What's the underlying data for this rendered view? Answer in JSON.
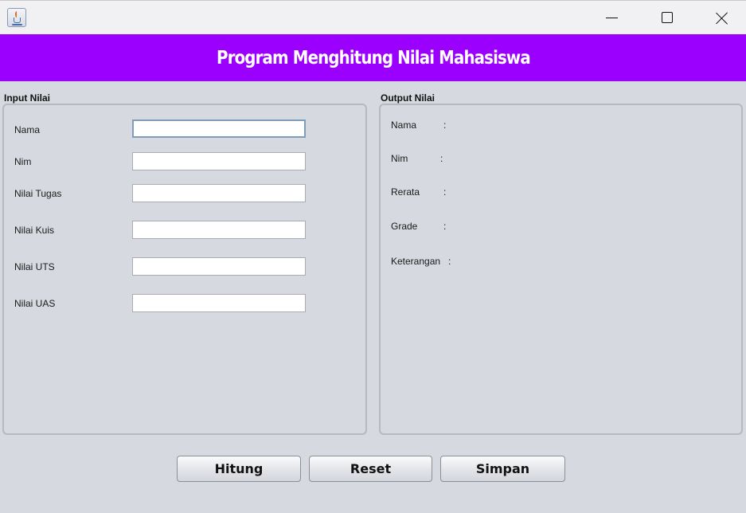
{
  "window": {
    "app_icon": "java-coffee-cup-icon",
    "controls": {
      "minimize": "minimize-icon",
      "maximize": "maximize-icon",
      "close": "close-icon"
    }
  },
  "banner": {
    "title": "Program Menghitung Nilai Mahasiswa",
    "color": "#9b00ff"
  },
  "input_panel": {
    "title": "Input Nilai",
    "fields": [
      {
        "label": "Nama",
        "value": ""
      },
      {
        "label": "Nim",
        "value": ""
      },
      {
        "label": "Nilai Tugas",
        "value": ""
      },
      {
        "label": "Nilai Kuis",
        "value": ""
      },
      {
        "label": "Nilai UTS",
        "value": ""
      },
      {
        "label": "Nilai UAS",
        "value": ""
      }
    ]
  },
  "output_panel": {
    "title": "Output Nilai",
    "rows": [
      {
        "label": "Nama",
        "colon": ":"
      },
      {
        "label": "Nim",
        "colon": ":"
      },
      {
        "label": "Rerata",
        "colon": ":"
      },
      {
        "label": "Grade",
        "colon": ":"
      },
      {
        "label": "Keterangan",
        "colon": ":"
      }
    ]
  },
  "buttons": {
    "hitung": "Hitung",
    "reset": "Reset",
    "simpan": "Simpan"
  }
}
